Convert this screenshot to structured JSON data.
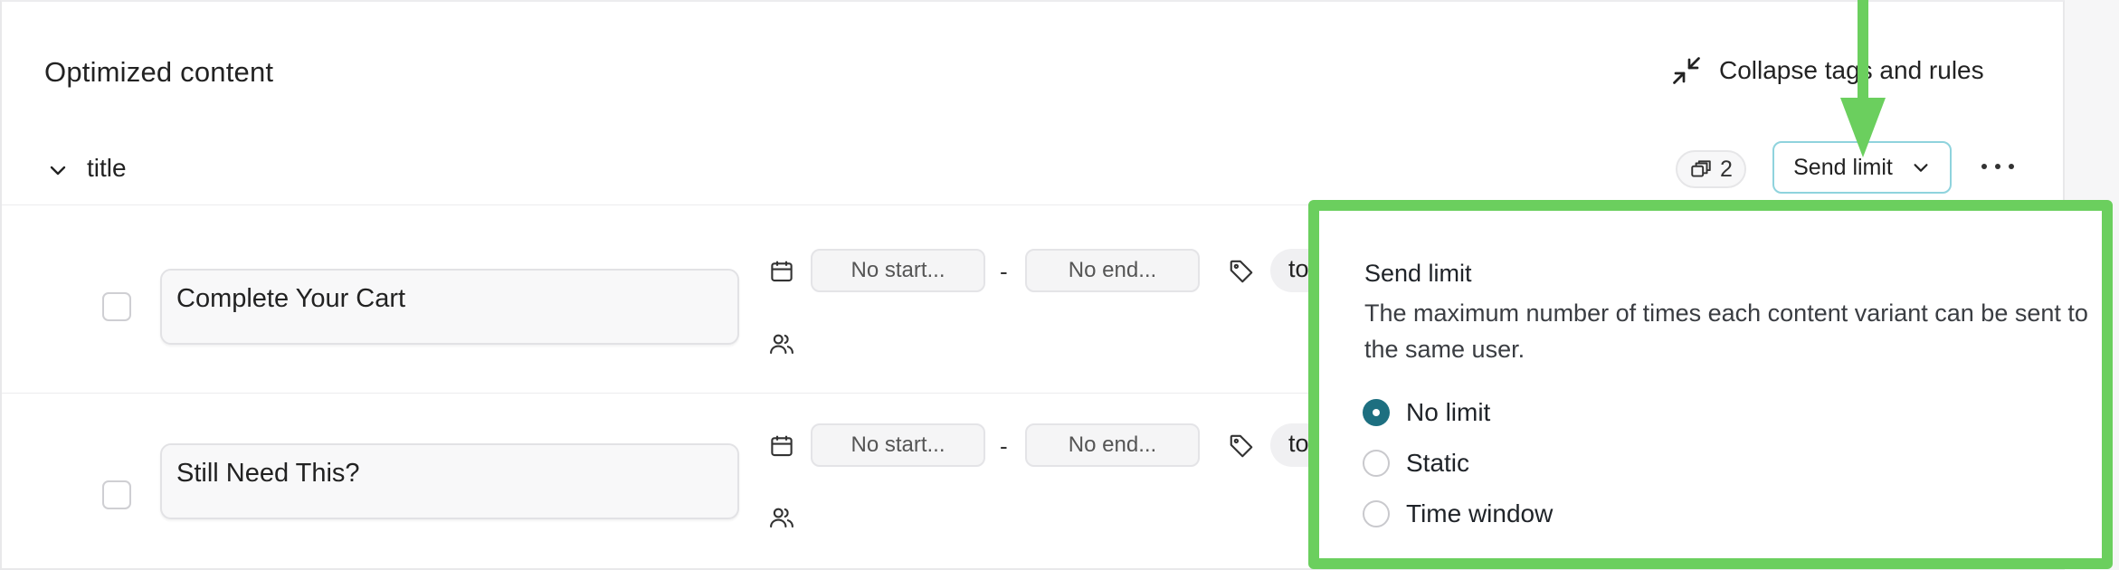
{
  "header": {
    "title": "Optimized content",
    "collapse_label": "Collapse tags and rules"
  },
  "group": {
    "title": "title",
    "variant_count": "2",
    "send_limit_label": "Send limit"
  },
  "rows": [
    {
      "text": "Complete Your Cart",
      "start_placeholder": "No start...",
      "end_placeholder": "No end...",
      "tag": "to"
    },
    {
      "text": "Still Need This?",
      "start_placeholder": "No start...",
      "end_placeholder": "No end...",
      "tag": "to"
    }
  ],
  "date_separator": "-",
  "popover": {
    "title": "Send limit",
    "description": "The maximum number of times each content variant can be sent to the same user.",
    "options": [
      {
        "label": "No limit",
        "selected": true
      },
      {
        "label": "Static",
        "selected": false
      },
      {
        "label": "Time window",
        "selected": false
      }
    ]
  },
  "colors": {
    "highlight": "#6bcf5e",
    "radio_selected": "#1d6f80",
    "send_limit_border": "#8fd3dd"
  },
  "icons": [
    "collapse-icon",
    "chevron-down-icon",
    "variants-icon",
    "more-icon",
    "calendar-icon",
    "users-icon",
    "tag-icon"
  ]
}
